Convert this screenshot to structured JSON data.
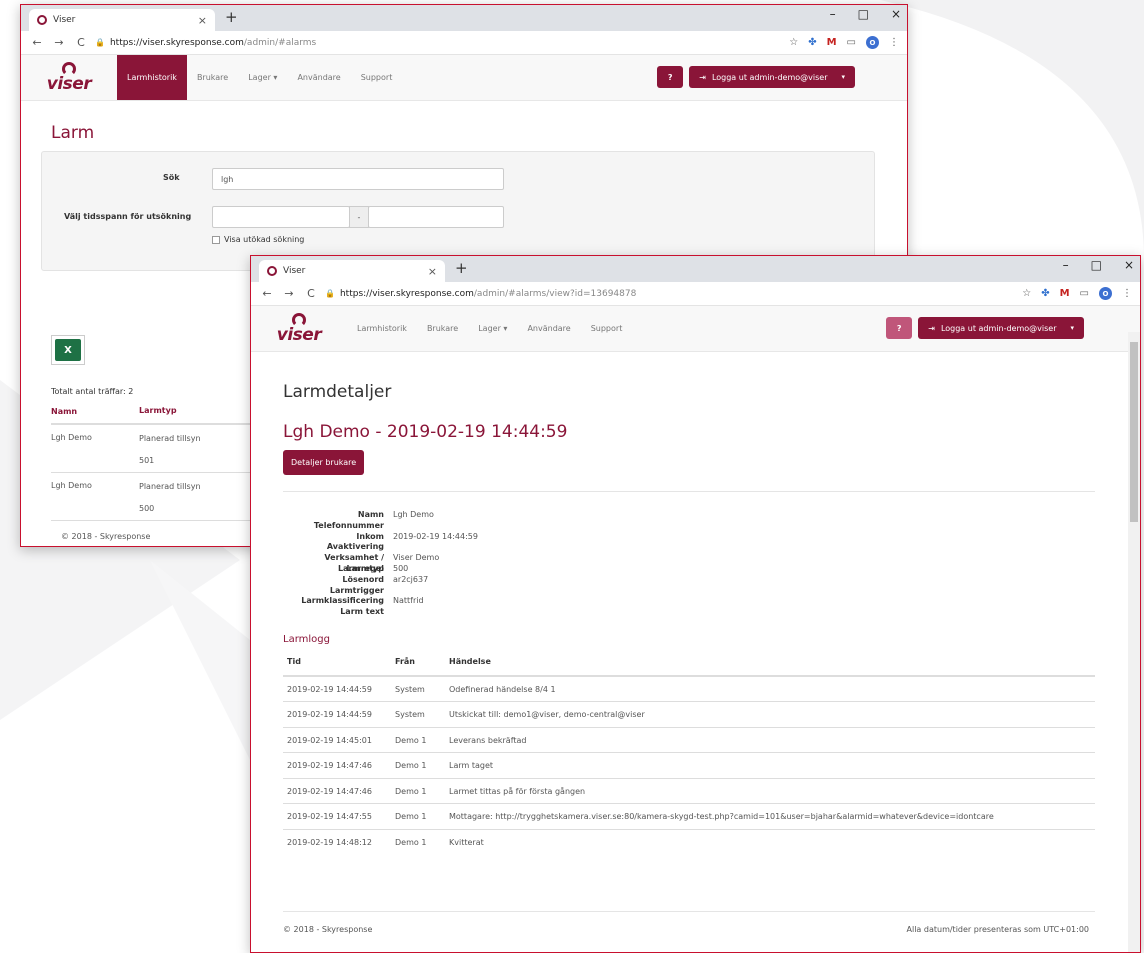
{
  "colors": {
    "brand": "#8a1538",
    "border": "#c8102e",
    "excel": "#1e7145"
  },
  "browser": {
    "tab_title": "Viser",
    "new_tab": "+",
    "win_min": "–",
    "win_max": "□",
    "win_close": "×",
    "back": "←",
    "forward": "→",
    "reload": "C"
  },
  "nav": {
    "logo": "viser",
    "items": [
      "Larmhistorik",
      "Brukare",
      "Lager ▾",
      "Användare",
      "Support"
    ],
    "help_label": "?",
    "logout_label": "Logga ut admin-demo@viser",
    "logout_icon": "⇥",
    "caret": "▾"
  },
  "win1": {
    "url_host": "https://viser.skyresponse.com",
    "url_path": "/admin/#alarms",
    "title": "Larm",
    "search_label": "Sök",
    "search_value": "lgh",
    "timespan_label": "Välj tidsspann för utsökning",
    "dash": "-",
    "extended_search": "Visa utökad sökning",
    "excel_label": "X",
    "total": "Totalt antal träffar: 2",
    "col_name": "Namn",
    "col_type": "Larmtyp",
    "rows": [
      {
        "name": "Lgh Demo",
        "type": "Planerad tillsyn",
        "code": "501"
      },
      {
        "name": "Lgh Demo",
        "type": "Planerad tillsyn",
        "code": "500"
      }
    ],
    "footer": "© 2018 - Skyresponse"
  },
  "win2": {
    "url_host": "https://viser.skyresponse.com",
    "url_path": "/admin/#alarms/view?id=13694878",
    "title": "Larmdetaljer",
    "subtitle": "Lgh Demo - 2019-02-19 14:44:59",
    "detail_button": "Detaljer brukare",
    "details": [
      {
        "key": "Namn",
        "value": "Lgh Demo"
      },
      {
        "key": "Telefonnummer",
        "value": ""
      },
      {
        "key": "Inkom",
        "value": "2019-02-19 14:44:59"
      },
      {
        "key": "Avaktivering",
        "value": ""
      },
      {
        "key": "Verksamhet / Larmregel",
        "value": "Viser Demo"
      },
      {
        "key": "Larmtyp",
        "value": "500"
      },
      {
        "key": "Lösenord",
        "value": "ar2cj637"
      },
      {
        "key": "Larmtrigger",
        "value": ""
      },
      {
        "key": "Larmklassificering",
        "value": "Nattfrid"
      },
      {
        "key": "Larm text",
        "value": ""
      }
    ],
    "log_title": "Larmlogg",
    "log_headers": [
      "Tid",
      "Från",
      "Händelse"
    ],
    "log": [
      {
        "time": "2019-02-19 14:44:59",
        "from": "System",
        "event": "Odefinerad händelse 8/4 1"
      },
      {
        "time": "2019-02-19 14:44:59",
        "from": "System",
        "event": "Utskickat till: demo1@viser, demo-central@viser"
      },
      {
        "time": "2019-02-19 14:45:01",
        "from": "Demo 1",
        "event": "Leverans bekräftad"
      },
      {
        "time": "2019-02-19 14:47:46",
        "from": "Demo 1",
        "event": "Larm taget"
      },
      {
        "time": "2019-02-19 14:47:46",
        "from": "Demo 1",
        "event": "Larmet tittas på för första gången"
      },
      {
        "time": "2019-02-19 14:47:55",
        "from": "Demo 1",
        "event": "Mottagare: http://trygghetskamera.viser.se:80/kamera-skygd-test.php?camid=101&user=bjahar&alarmid=whatever&device=idontcare"
      },
      {
        "time": "2019-02-19 14:48:12",
        "from": "Demo 1",
        "event": "Kvitterat"
      }
    ],
    "footer_left": "© 2018 - Skyresponse",
    "footer_right": "Alla datum/tider presenteras som UTC+01:00"
  }
}
